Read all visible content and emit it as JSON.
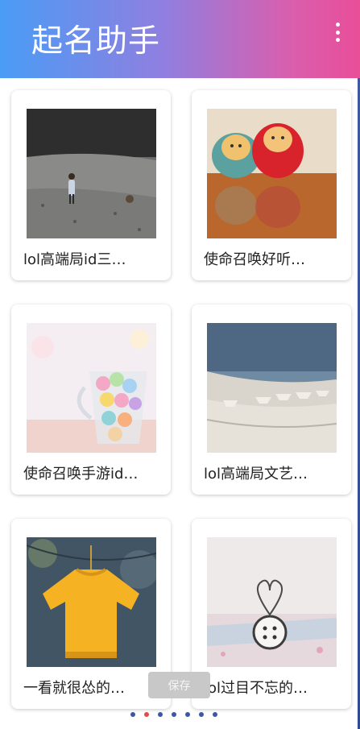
{
  "header": {
    "title": "起名助手",
    "menu_icon": "more-vertical-icon"
  },
  "cards": [
    {
      "caption": "lol高端局id三…",
      "image": "girl-with-snail-photo"
    },
    {
      "caption": "使命召唤好听…",
      "image": "daruma-dolls-photo"
    },
    {
      "caption": "使命召唤手游id…",
      "image": "candy-cup-photo"
    },
    {
      "caption": "lol高端局文艺…",
      "image": "paper-boats-photo"
    },
    {
      "caption": "一看就很怂的…",
      "image": "yellow-sweater-photo"
    },
    {
      "caption": "lol过目不忘的…",
      "image": "button-and-heart-photo"
    }
  ],
  "toast": {
    "text": "保存"
  },
  "pagination": {
    "count": 7,
    "active_index": 1
  },
  "colors": {
    "accent_start": "#4a9cf5",
    "accent_end": "#e94e99",
    "dot": "#3d56a6",
    "dot_active": "#e34a4a"
  }
}
